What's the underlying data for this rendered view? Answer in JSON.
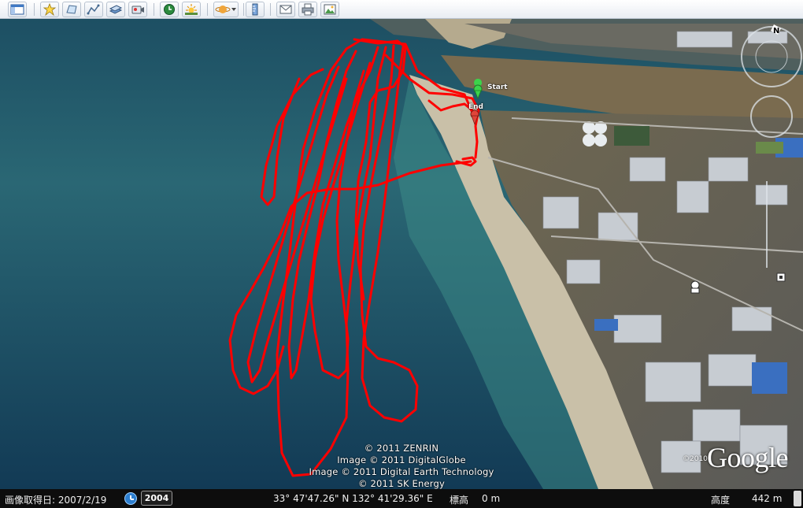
{
  "toolbar": {
    "buttons": [
      {
        "icon": "sidebar-toggle-icon"
      },
      {
        "icon": "add-placemark-icon"
      },
      {
        "icon": "add-polygon-icon"
      },
      {
        "icon": "add-path-icon"
      },
      {
        "icon": "add-image-overlay-icon"
      },
      {
        "icon": "record-tour-icon"
      },
      {
        "icon": "historical-imagery-icon"
      },
      {
        "icon": "sunlight-icon"
      },
      {
        "icon": "switch-planet-icon"
      },
      {
        "icon": "ruler-icon"
      },
      {
        "icon": "email-icon"
      },
      {
        "icon": "print-icon"
      },
      {
        "icon": "save-image-icon"
      }
    ]
  },
  "map": {
    "track_color": "#ff0000",
    "pins": {
      "start_label": "Start",
      "end_label": "End"
    },
    "copyright_lines": [
      "© 2011 ZENRIN",
      "Image © 2011 DigitalGlobe",
      "Image © 2011 Digital Earth Technology",
      "© 2011 SK Energy"
    ],
    "logo_text": "Google",
    "logo_year": "©2010"
  },
  "status_bar": {
    "imagery_date": "画像取得日: 2007/2/19",
    "historical_year": "2004",
    "coordinates": "33° 47'47.26\" N 132° 41'29.36\" E",
    "elevation_label": "標高",
    "elevation_value": "0 m",
    "eye_alt_label": "高度",
    "eye_alt_value": "442 m"
  }
}
